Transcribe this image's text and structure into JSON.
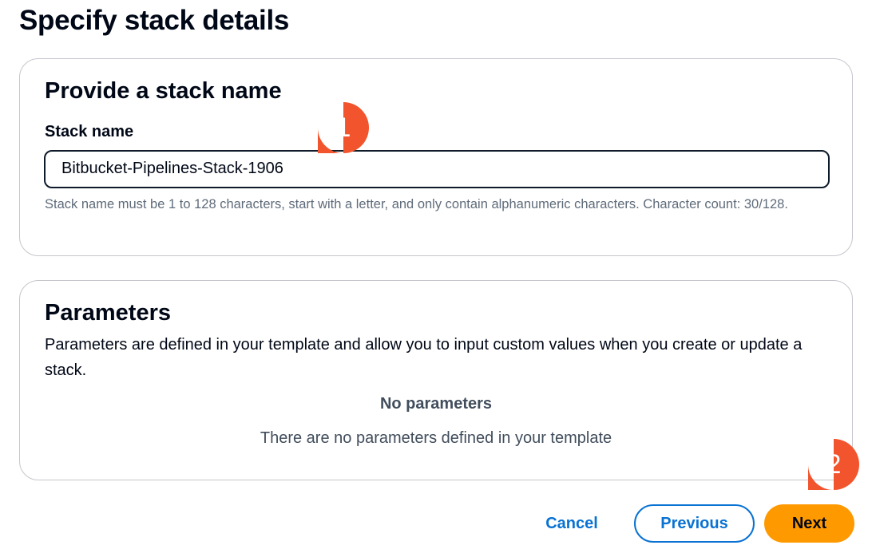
{
  "page": {
    "title": "Specify stack details"
  },
  "stack_section": {
    "heading": "Provide a stack name",
    "field_label": "Stack name",
    "field_value": "Bitbucket-Pipelines-Stack-1906",
    "hint": "Stack name must be 1 to 128 characters, start with a letter, and only contain alphanumeric characters. Character count: 30/128."
  },
  "parameters_section": {
    "heading": "Parameters",
    "description": "Parameters are defined in your template and allow you to input custom values when you create or update a stack.",
    "empty_title": "No parameters",
    "empty_subtitle": "There are no parameters defined in your template"
  },
  "actions": {
    "cancel_label": "Cancel",
    "previous_label": "Previous",
    "next_label": "Next"
  },
  "annotations": {
    "marker_1": "1",
    "marker_2": "2",
    "marker_color": "#f2542d"
  },
  "colors": {
    "primary_blue": "#0972d3",
    "next_orange": "#ff9900",
    "text_dark": "#000716",
    "text_muted": "#5f6b7a"
  }
}
